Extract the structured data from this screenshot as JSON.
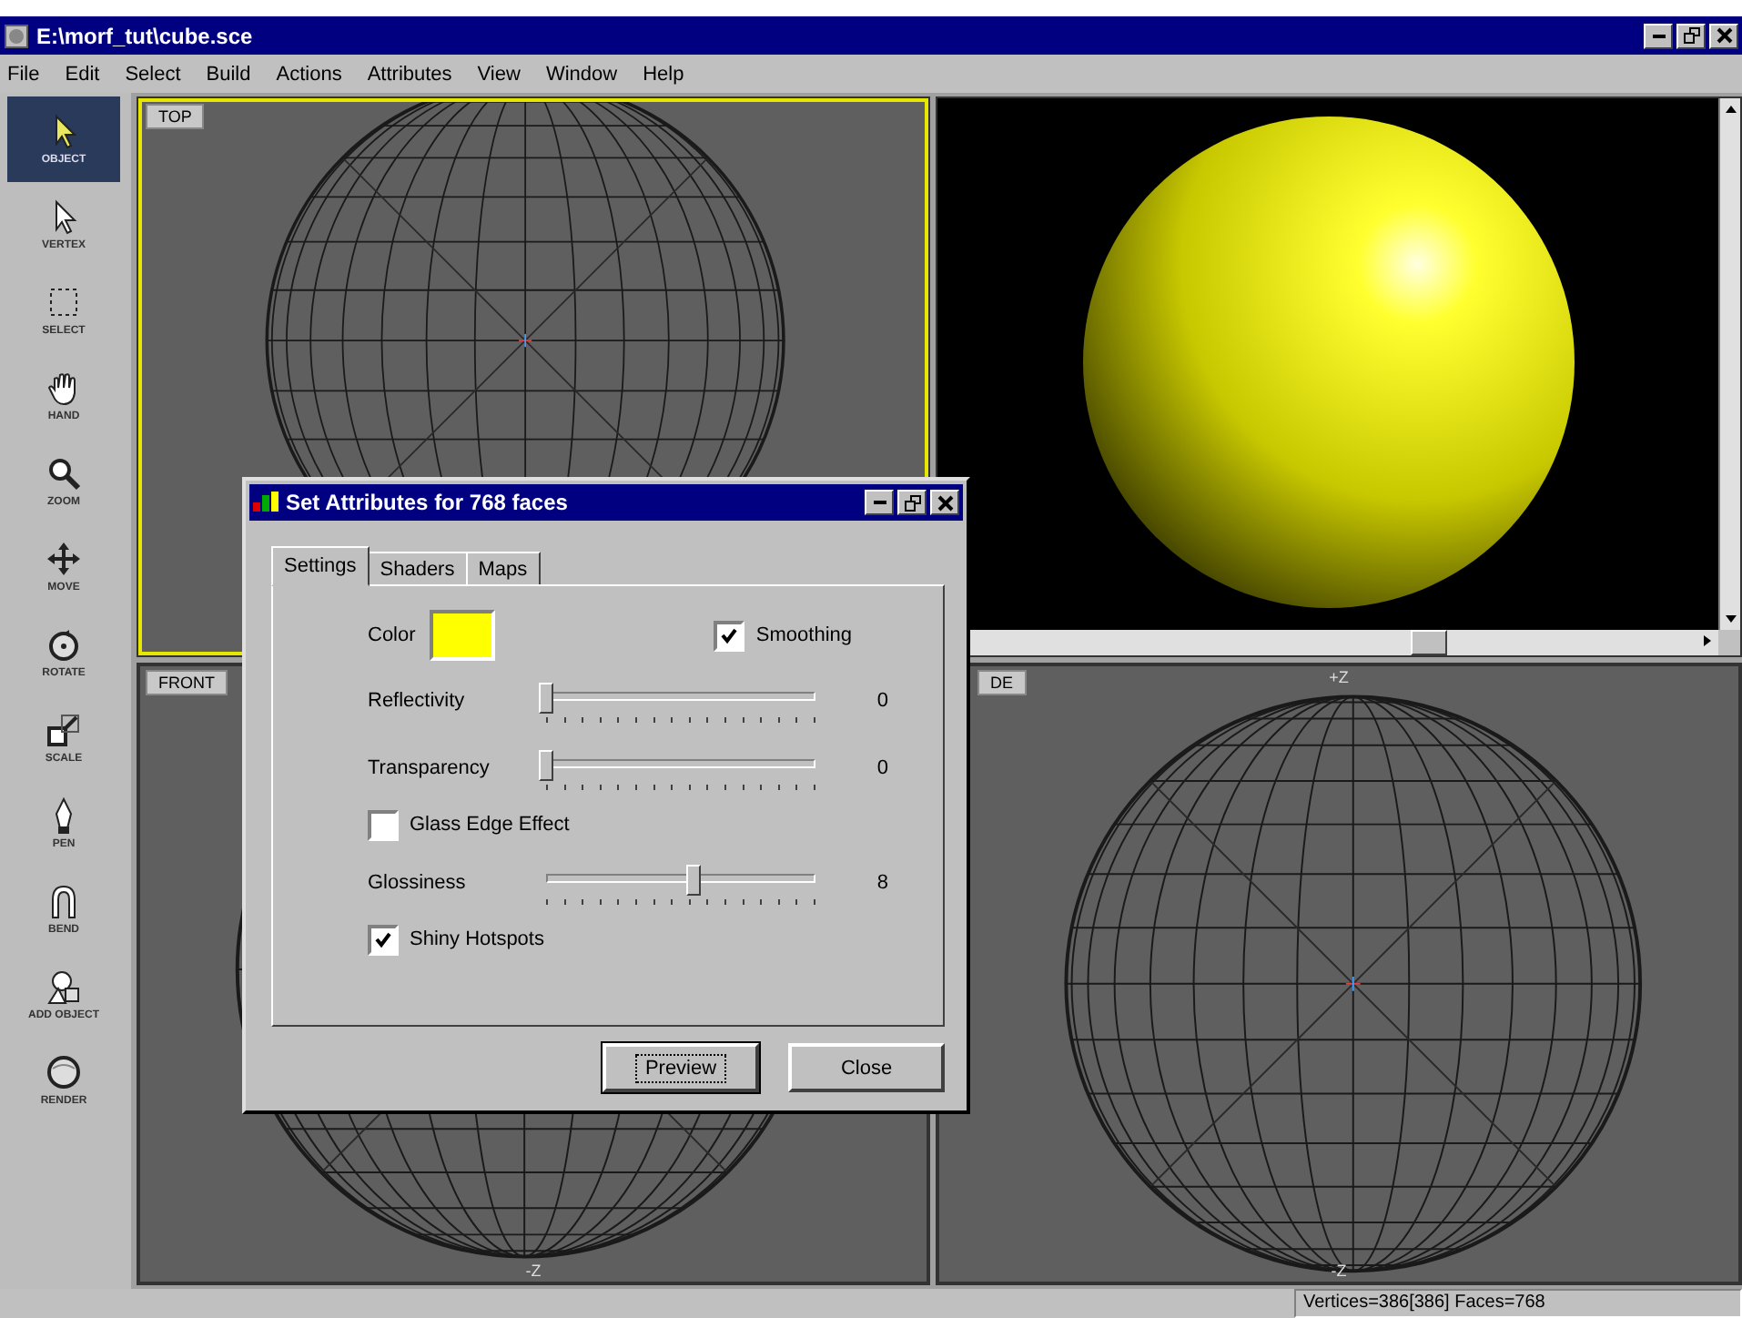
{
  "window": {
    "title": "E:\\morf_tut\\cube.sce"
  },
  "menu": [
    "File",
    "Edit",
    "Select",
    "Build",
    "Actions",
    "Attributes",
    "View",
    "Window",
    "Help"
  ],
  "toolbar": [
    {
      "label": "OBJECT",
      "selected": true
    },
    {
      "label": "VERTEX",
      "selected": false
    },
    {
      "label": "SELECT",
      "selected": false
    },
    {
      "label": "HAND",
      "selected": false
    },
    {
      "label": "ZOOM",
      "selected": false
    },
    {
      "label": "MOVE",
      "selected": false
    },
    {
      "label": "ROTATE",
      "selected": false
    },
    {
      "label": "SCALE",
      "selected": false
    },
    {
      "label": "PEN",
      "selected": false
    },
    {
      "label": "BEND",
      "selected": false
    },
    {
      "label": "ADD OBJECT",
      "selected": false
    },
    {
      "label": "RENDER",
      "selected": false
    }
  ],
  "viewports": [
    {
      "kind": "wireframe",
      "label": "TOP",
      "active": true
    },
    {
      "kind": "render"
    },
    {
      "kind": "wireframe",
      "label": "FRONT",
      "active": false,
      "axis_bottom": "-Z"
    },
    {
      "kind": "wireframe",
      "label": "DE",
      "active": false,
      "axis_top": "+Z",
      "axis_bottom": "-Z"
    }
  ],
  "dialog": {
    "title": "Set Attributes for 768 faces",
    "tabs": [
      {
        "label": "Settings",
        "selected": true
      },
      {
        "label": "Shaders",
        "selected": false
      },
      {
        "label": "Maps",
        "selected": false
      }
    ],
    "color": {
      "label": "Color",
      "color": "#ffff00"
    },
    "smoothing": {
      "label": "Smoothing",
      "checked": true
    },
    "controls": [
      {
        "kind": "slider",
        "label": "Reflectivity",
        "level": 0,
        "reading": "0"
      },
      {
        "kind": "slider",
        "label": "Transparency",
        "level": 0,
        "reading": "0"
      },
      {
        "kind": "checkbox",
        "label": "Glass Edge Effect",
        "checked": false
      },
      {
        "kind": "slider",
        "label": "Glossiness",
        "level": 0.55,
        "reading": "8"
      },
      {
        "kind": "checkbox",
        "label": "Shiny Hotspots",
        "checked": true
      }
    ],
    "buttons": [
      {
        "label": "Preview",
        "focused": true
      },
      {
        "label": "Close",
        "focused": false
      }
    ]
  },
  "status_bar": {
    "text": "Vertices=386[386] Faces=768"
  }
}
